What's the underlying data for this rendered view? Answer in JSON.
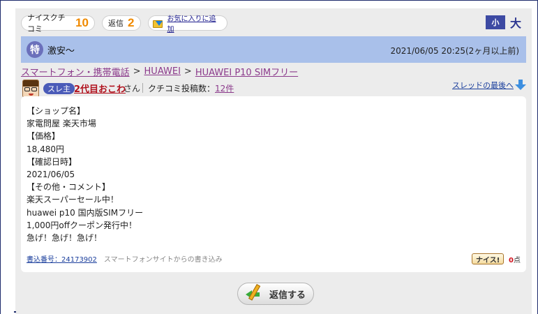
{
  "stats": {
    "nice_label": "ナイスクチコミ",
    "nice_count": "10",
    "reply_label": "返信",
    "reply_count": "2",
    "favorite_label": "お気に入りに追加"
  },
  "font_size": {
    "small": "小",
    "large": "大"
  },
  "thread": {
    "badge": "特",
    "title": "激安〜",
    "date": "2021/06/05 20:25(2ヶ月以上前)"
  },
  "breadcrumb": [
    {
      "label": "スマートフォン・携帯電話"
    },
    {
      "label": "HUAWEI"
    },
    {
      "label": "HUAWEI P10 SIMフリー"
    }
  ],
  "breadcrumb_sep": ">",
  "author": {
    "badge": "スレ主",
    "name": "2代目おこわ",
    "suffix": "さん",
    "post_count_label": "クチコミ投稿数：",
    "post_count": "12件",
    "thread_last_label": "スレッドの最後へ"
  },
  "post": {
    "lines": [
      "【ショップ名】",
      "家電問屋 楽天市場",
      "【価格】",
      "18,480円",
      "【確認日時】",
      "2021/06/05",
      "【その他・コメント】",
      "楽天スーパーセール中！",
      "huawei p10 国内版SIMフリー",
      "1,000円offクーポン発行中！",
      "急げ！急げ！急げ！"
    ],
    "post_number": "書込番号：24173902",
    "source_note": "スマートフォンサイトからの書き込み",
    "nice_button": "ナイス!",
    "nice_points": "0",
    "nice_unit": "点"
  },
  "reply_button": "返信する",
  "colors": {
    "title_bar": "#a9c0ea",
    "accent_orange": "#f08a00",
    "author_red": "#b0101c",
    "link_purple": "#8b3a8b"
  }
}
